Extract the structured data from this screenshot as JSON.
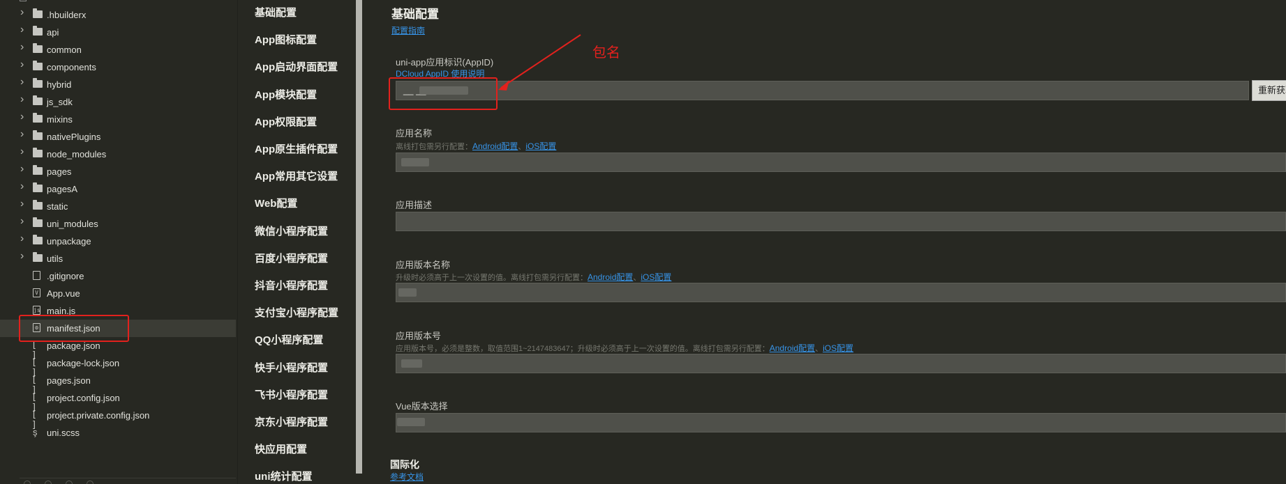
{
  "file_tree": {
    "items": [
      {
        "label": ".hbuilderx",
        "type": "folder"
      },
      {
        "label": "api",
        "type": "folder"
      },
      {
        "label": "common",
        "type": "folder"
      },
      {
        "label": "components",
        "type": "folder"
      },
      {
        "label": "hybrid",
        "type": "folder"
      },
      {
        "label": "js_sdk",
        "type": "folder"
      },
      {
        "label": "mixins",
        "type": "folder"
      },
      {
        "label": "nativePlugins",
        "type": "folder"
      },
      {
        "label": "node_modules",
        "type": "folder"
      },
      {
        "label": "pages",
        "type": "folder"
      },
      {
        "label": "pagesA",
        "type": "folder"
      },
      {
        "label": "static",
        "type": "folder"
      },
      {
        "label": "uni_modules",
        "type": "folder"
      },
      {
        "label": "unpackage",
        "type": "folder"
      },
      {
        "label": "utils",
        "type": "folder"
      },
      {
        "label": ".gitignore",
        "type": "file"
      },
      {
        "label": "App.vue",
        "type": "vue"
      },
      {
        "label": "main.js",
        "type": "js"
      },
      {
        "label": "manifest.json",
        "type": "manifest"
      },
      {
        "label": "package.json",
        "type": "json"
      },
      {
        "label": "package-lock.json",
        "type": "json"
      },
      {
        "label": "pages.json",
        "type": "json"
      },
      {
        "label": "project.config.json",
        "type": "json"
      },
      {
        "label": "project.private.config.json",
        "type": "json"
      },
      {
        "label": "uni.scss",
        "type": "scss"
      }
    ],
    "selected": "manifest.json"
  },
  "settings_nav": {
    "items": [
      "基础配置",
      "App图标配置",
      "App启动界面配置",
      "App模块配置",
      "App权限配置",
      "App原生插件配置",
      "App常用其它设置",
      "Web配置",
      "微信小程序配置",
      "百度小程序配置",
      "抖音小程序配置",
      "支付宝小程序配置",
      "QQ小程序配置",
      "快手小程序配置",
      "飞书小程序配置",
      "京东小程序配置",
      "快应用配置",
      "uni统计配置"
    ]
  },
  "main": {
    "title": "基础配置",
    "guide_link": "配置指南",
    "appid": {
      "label": "uni-app应用标识(AppID)",
      "help_link": "DCloud AppID 使用说明",
      "value": "__ __",
      "refetch_label": "重新获取"
    },
    "app_name": {
      "label": "应用名称",
      "hint": "离线打包需另行配置：",
      "android_link": "Android配置",
      "ios_link": "iOS配置"
    },
    "app_desc": {
      "label": "应用描述"
    },
    "version_name": {
      "label": "应用版本名称",
      "hint": "升级时必须高于上一次设置的值。离线打包需另行配置：",
      "android_link": "Android配置",
      "ios_link": "iOS配置"
    },
    "version_code": {
      "label": "应用版本号",
      "hint": "应用版本号，必须是整数，取值范围1~2147483647；升级时必须高于上一次设置的值。离线打包需另行配置：",
      "android_link": "Android配置",
      "ios_link": "iOS配置"
    },
    "vue_version": {
      "label": "Vue版本选择"
    },
    "i18n": {
      "title": "国际化",
      "doc_link": "参考文档"
    }
  },
  "annotation": {
    "text": "包名",
    "color": "#e2211d"
  },
  "colors": {
    "background": "#272822",
    "link": "#3794e8",
    "input_bg": "#4f504a"
  }
}
